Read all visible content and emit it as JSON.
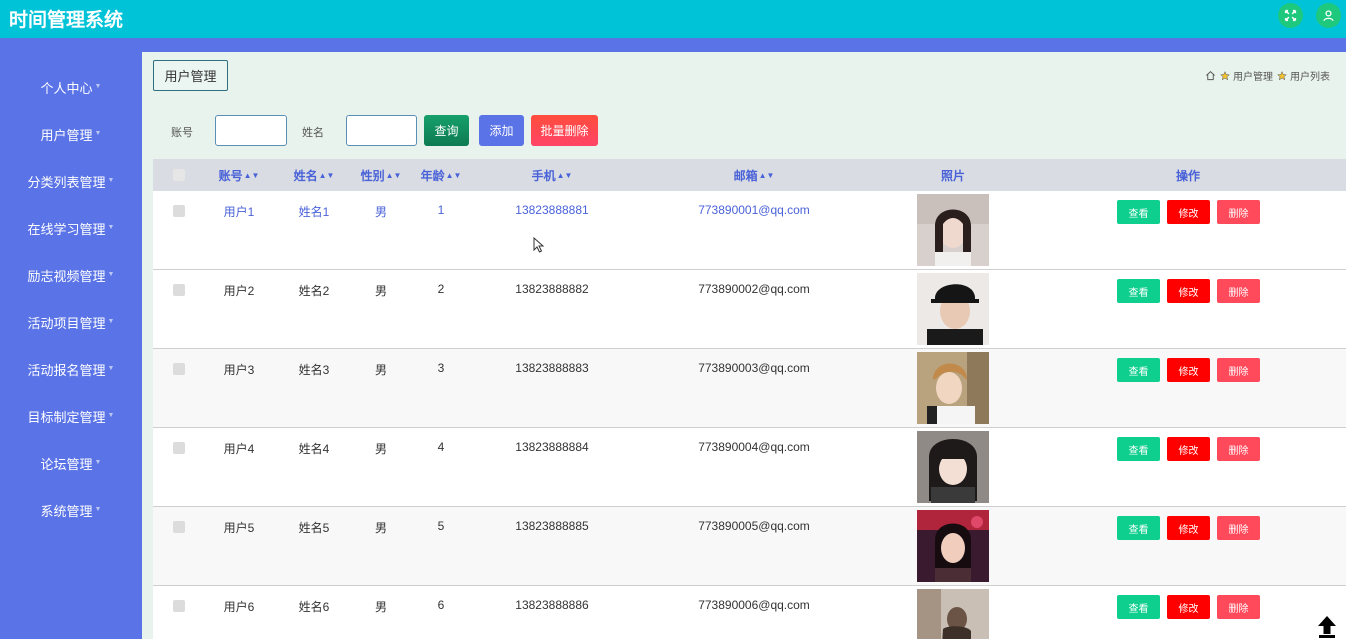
{
  "app": {
    "title": "时间管理系统"
  },
  "header": {
    "icons": [
      "fullscreen-icon",
      "user-icon"
    ]
  },
  "sidebar": {
    "items": [
      {
        "label": "个人中心"
      },
      {
        "label": "用户管理"
      },
      {
        "label": "分类列表管理"
      },
      {
        "label": "在线学习管理"
      },
      {
        "label": "励志视频管理"
      },
      {
        "label": "活动项目管理"
      },
      {
        "label": "活动报名管理"
      },
      {
        "label": "目标制定管理"
      },
      {
        "label": "论坛管理"
      },
      {
        "label": "系统管理"
      }
    ]
  },
  "page": {
    "tag": "用户管理",
    "breadcrumb": [
      "用户管理",
      "用户列表"
    ]
  },
  "search": {
    "account_label": "账号",
    "account_value": "",
    "name_label": "姓名",
    "name_value": "",
    "query_label": "查询",
    "add_label": "添加",
    "batch_delete_label": "批量删除"
  },
  "table": {
    "columns": {
      "account": "账号",
      "name": "姓名",
      "gender": "性别",
      "age": "年龄",
      "phone": "手机",
      "email": "邮箱",
      "photo": "照片",
      "ops": "操作"
    },
    "actions": {
      "view": "查看",
      "edit": "修改",
      "delete": "删除"
    },
    "rows": [
      {
        "account": "用户1",
        "name": "姓名1",
        "gender": "男",
        "age": "1",
        "phone": "13823888881",
        "email": "773890001@qq.com"
      },
      {
        "account": "用户2",
        "name": "姓名2",
        "gender": "男",
        "age": "2",
        "phone": "13823888882",
        "email": "773890002@qq.com"
      },
      {
        "account": "用户3",
        "name": "姓名3",
        "gender": "男",
        "age": "3",
        "phone": "13823888883",
        "email": "773890003@qq.com"
      },
      {
        "account": "用户4",
        "name": "姓名4",
        "gender": "男",
        "age": "4",
        "phone": "13823888884",
        "email": "773890004@qq.com"
      },
      {
        "account": "用户5",
        "name": "姓名5",
        "gender": "男",
        "age": "5",
        "phone": "13823888885",
        "email": "773890005@qq.com"
      },
      {
        "account": "用户6",
        "name": "姓名6",
        "gender": "男",
        "age": "6",
        "phone": "13823888886",
        "email": "773890006@qq.com"
      }
    ]
  },
  "colors": {
    "header": "#00c3d8",
    "sidebar": "#5a73e6",
    "query_button": "#138a5e",
    "add_button": "#5a73e6",
    "batch_delete_button": "#ff4a4a",
    "view_button": "#0ecf8d",
    "edit_button": "#ff0000",
    "delete_button": "#ff4a5c"
  }
}
